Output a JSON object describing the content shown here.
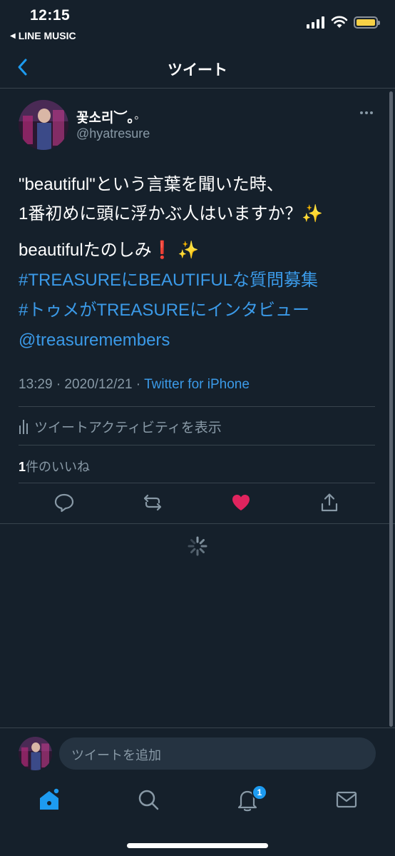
{
  "status_bar": {
    "time": "12:15",
    "back_app": "LINE MUSIC"
  },
  "header": {
    "title": "ツイート"
  },
  "tweet": {
    "user_name": "꽃소리︶｡◦",
    "user_handle": "@hyatresure",
    "text_lines": [
      "\"beautiful\"という言葉を聞いた時、",
      "1番初めに頭に浮かぶ人はいますか？✨"
    ],
    "line3": "beautifulたのしみ❗️ ✨",
    "hashtags": [
      "#TREASUREにBEAUTIFULな質問募集",
      "#トゥメがTREASUREにインタビュー"
    ],
    "mention": "@treasuremembers",
    "time": "13:29 · 2020/12/21 · ",
    "source": "Twitter for iPhone",
    "activity_label": "ツイートアクティビティを表示",
    "likes_count": "1",
    "likes_label": "件のいいね"
  },
  "compose": {
    "placeholder": "ツイートを追加"
  },
  "tabbar": {
    "notification_badge": "1"
  },
  "colors": {
    "background": "#15202b",
    "accent": "#1d9bf0",
    "like": "#e0245e",
    "muted": "#8899a6"
  }
}
